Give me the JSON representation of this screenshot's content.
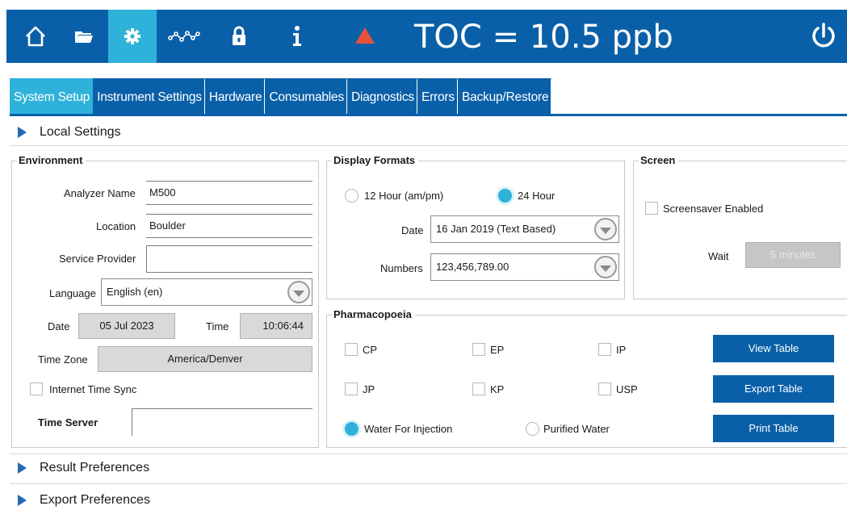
{
  "header": {
    "title": "TOC = 10.5 ppb",
    "icons": [
      "home-icon",
      "folder-icon",
      "gear-icon",
      "trend-icon",
      "lock-icon",
      "info-icon",
      "alarm-icon",
      "power-icon"
    ],
    "colors": {
      "bar": "#0a60a8",
      "active": "#2fb2d9",
      "alarm": "#e8503a"
    }
  },
  "tabs": [
    {
      "label": "System Setup",
      "active": true
    },
    {
      "label": "Instrument Settings",
      "active": false
    },
    {
      "label": "Hardware",
      "active": false
    },
    {
      "label": "Consumables",
      "active": false
    },
    {
      "label": "Diagnostics",
      "active": false
    },
    {
      "label": "Errors",
      "active": false
    },
    {
      "label": "Backup/Restore",
      "active": false
    }
  ],
  "sections": {
    "local_settings": "Local Settings",
    "result_preferences": "Result Preferences",
    "export_preferences": "Export Preferences"
  },
  "environment": {
    "title": "Environment",
    "analyzer_name_label": "Analyzer Name",
    "analyzer_name_value": "M500",
    "location_label": "Location",
    "location_value": "Boulder",
    "service_provider_label": "Service Provider",
    "service_provider_value": "",
    "language_label": "Language",
    "language_value": "English (en)",
    "date_label": "Date",
    "date_value": "05 Jul 2023",
    "time_label": "Time",
    "time_value": "10:06:44",
    "timezone_label": "Time Zone",
    "timezone_value": "America/Denver",
    "internet_time_sync_label": "Internet Time Sync",
    "internet_time_sync_checked": false,
    "time_server_label": "Time Server",
    "time_server_value": ""
  },
  "display_formats": {
    "title": "Display Formats",
    "hour12_label": "12 Hour (am/pm)",
    "hour24_label": "24 Hour",
    "selected_hour_format": "24 Hour",
    "date_label": "Date",
    "date_value": "16 Jan 2019 (Text Based)",
    "numbers_label": "Numbers",
    "numbers_value": "123,456,789.00"
  },
  "screen": {
    "title": "Screen",
    "screensaver_label": "Screensaver Enabled",
    "screensaver_checked": false,
    "wait_label": "Wait",
    "wait_value": "5 minutes"
  },
  "pharmacopoeia": {
    "title": "Pharmacopoeia",
    "checkboxes": [
      "CP",
      "EP",
      "IP",
      "JP",
      "KP",
      "USP"
    ],
    "water_injection_label": "Water For Injection",
    "purified_water_label": "Purified Water",
    "selected_water": "Water For Injection",
    "view_table_label": "View Table",
    "export_table_label": "Export Table",
    "print_table_label": "Print Table"
  }
}
